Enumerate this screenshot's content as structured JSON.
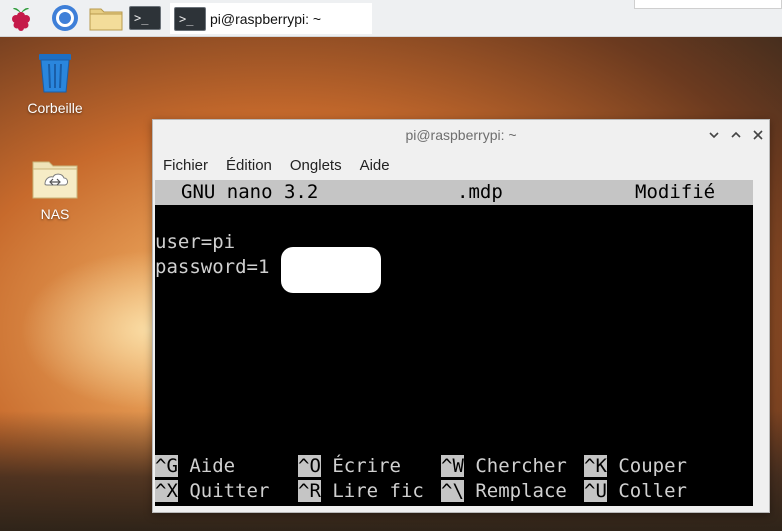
{
  "taskbar": {
    "active_task_label": "pi@raspberrypi: ~"
  },
  "desktop": {
    "icons": [
      {
        "label": "Corbeille"
      },
      {
        "label": "NAS"
      }
    ]
  },
  "window": {
    "title": "pi@raspberrypi: ~",
    "menu": [
      "Fichier",
      "Édition",
      "Onglets",
      "Aide"
    ]
  },
  "nano": {
    "header": {
      "app": "GNU nano 3.2",
      "file": ".mdp",
      "status": "Modifié"
    },
    "lines": [
      "user=pi",
      "password=1"
    ],
    "shortcuts": [
      {
        "key": "^G",
        "label": "Aide"
      },
      {
        "key": "^O",
        "label": "Écrire"
      },
      {
        "key": "^W",
        "label": "Chercher"
      },
      {
        "key": "^K",
        "label": "Couper"
      },
      {
        "key": "^X",
        "label": "Quitter"
      },
      {
        "key": "^R",
        "label": "Lire fic"
      },
      {
        "key": "^\\",
        "label": "Remplace"
      },
      {
        "key": "^U",
        "label": "Coller"
      }
    ]
  },
  "colors": {
    "panel": "#eef0f2",
    "terminal_bg": "#000000",
    "nano_bar": "#c5c5c5",
    "rpi_red": "#c51a4a",
    "rpi_green": "#2e9c3a"
  },
  "icons": [
    "raspberry-pi-icon",
    "browser-icon",
    "folder-icon",
    "terminal-icon",
    "trash-icon",
    "nas-folder-icon"
  ]
}
